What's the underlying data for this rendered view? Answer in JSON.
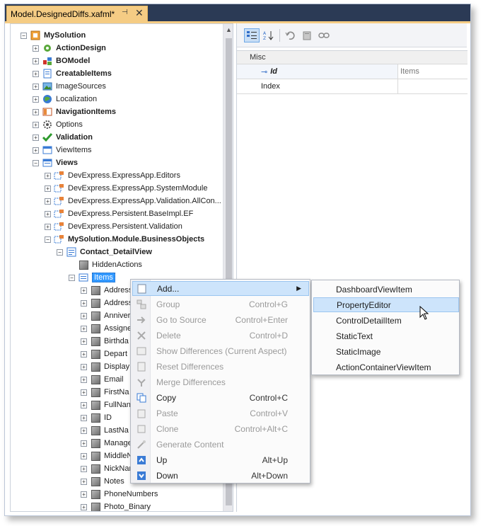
{
  "tab": {
    "title": "Model.DesignedDiffs.xafml*",
    "pin_glyph": "⊣",
    "close_glyph": "✕"
  },
  "tree": {
    "items": [
      {
        "label": "MySolution",
        "bold": true,
        "icon": "solution-icon"
      },
      {
        "label": "ActionDesign",
        "bold": true,
        "icon": "action-design-icon"
      },
      {
        "label": "BOModel",
        "bold": true,
        "icon": "bo-model-icon"
      },
      {
        "label": "CreatableItems",
        "bold": true,
        "icon": "creatable-items-icon"
      },
      {
        "label": "ImageSources",
        "bold": false,
        "icon": "image-sources-icon"
      },
      {
        "label": "Localization",
        "bold": false,
        "icon": "localization-icon"
      },
      {
        "label": "NavigationItems",
        "bold": true,
        "icon": "navigation-items-icon"
      },
      {
        "label": "Options",
        "bold": false,
        "icon": "options-icon"
      },
      {
        "label": "Validation",
        "bold": true,
        "icon": "validation-icon"
      },
      {
        "label": "ViewItems",
        "bold": false,
        "icon": "view-items-icon"
      },
      {
        "label": "Views",
        "bold": true,
        "icon": "views-icon"
      },
      {
        "label": "DevExpress.ExpressApp.Editors",
        "bold": false,
        "icon": "namespace-icon"
      },
      {
        "label": "DevExpress.ExpressApp.SystemModule",
        "bold": false,
        "icon": "namespace-icon"
      },
      {
        "label": "DevExpress.ExpressApp.Validation.AllCon...",
        "bold": false,
        "icon": "namespace-icon"
      },
      {
        "label": "DevExpress.Persistent.BaseImpl.EF",
        "bold": false,
        "icon": "namespace-icon"
      },
      {
        "label": "DevExpress.Persistent.Validation",
        "bold": false,
        "icon": "namespace-icon"
      },
      {
        "label": "MySolution.Module.BusinessObjects",
        "bold": true,
        "icon": "namespace-icon"
      },
      {
        "label": "Contact_DetailView",
        "bold": true,
        "icon": "detail-view-icon"
      },
      {
        "label": "HiddenActions",
        "bold": false,
        "icon": "cube-icon"
      },
      {
        "label": "Items",
        "bold": false,
        "icon": "items-icon"
      },
      {
        "label": "Address",
        "bold": false,
        "icon": "cube-icon"
      },
      {
        "label": "Address",
        "bold": false,
        "icon": "cube-icon"
      },
      {
        "label": "Anniver",
        "bold": false,
        "icon": "cube-icon"
      },
      {
        "label": "Assigne",
        "bold": false,
        "icon": "cube-icon"
      },
      {
        "label": "Birthda",
        "bold": false,
        "icon": "cube-icon"
      },
      {
        "label": "Depart",
        "bold": false,
        "icon": "cube-icon"
      },
      {
        "label": "Display",
        "bold": false,
        "icon": "cube-icon"
      },
      {
        "label": "Email",
        "bold": false,
        "icon": "cube-icon"
      },
      {
        "label": "FirstNa",
        "bold": false,
        "icon": "cube-icon"
      },
      {
        "label": "FullNan",
        "bold": false,
        "icon": "cube-icon"
      },
      {
        "label": "ID",
        "bold": false,
        "icon": "cube-icon"
      },
      {
        "label": "LastNa",
        "bold": false,
        "icon": "cube-icon"
      },
      {
        "label": "Manage",
        "bold": false,
        "icon": "cube-icon"
      },
      {
        "label": "MiddleN",
        "bold": false,
        "icon": "cube-icon"
      },
      {
        "label": "NickNan",
        "bold": false,
        "icon": "cube-icon"
      },
      {
        "label": "Notes",
        "bold": false,
        "icon": "cube-icon"
      },
      {
        "label": "PhoneNumbers",
        "bold": false,
        "icon": "cube-icon"
      },
      {
        "label": "Photo_Binary",
        "bold": false,
        "icon": "cube-icon"
      }
    ]
  },
  "property_grid": {
    "toolbar": {
      "categorized_icon": "categorized-icon",
      "alphabetical_icon": "alphabetical-icon",
      "undo_icon": "undo-icon",
      "delete_icon": "delete-icon",
      "link_icon": "link-icon"
    },
    "category": "Misc",
    "rows": [
      {
        "name": "Id",
        "value": "Items"
      },
      {
        "name": "Index",
        "value": ""
      }
    ]
  },
  "context_menu": {
    "items": [
      {
        "label": "Add...",
        "shortcut": "",
        "enabled": true,
        "icon": "add-icon",
        "submenu": true
      },
      {
        "label": "Group",
        "shortcut": "Control+G",
        "enabled": false,
        "icon": "group-icon"
      },
      {
        "label": "Go to Source",
        "shortcut": "Control+Enter",
        "enabled": false,
        "icon": "go-to-source-icon"
      },
      {
        "label": "Delete",
        "shortcut": "Control+D",
        "enabled": false,
        "icon": "delete-icon"
      },
      {
        "label": "Show Differences (Current Aspect)",
        "shortcut": "",
        "enabled": false,
        "icon": "show-differences-icon"
      },
      {
        "label": "Reset Differences",
        "shortcut": "",
        "enabled": false,
        "icon": "reset-differences-icon"
      },
      {
        "label": "Merge Differences",
        "shortcut": "",
        "enabled": false,
        "icon": "merge-differences-icon"
      },
      {
        "label": "Copy",
        "shortcut": "Control+C",
        "enabled": true,
        "icon": "copy-icon"
      },
      {
        "label": "Paste",
        "shortcut": "Control+V",
        "enabled": false,
        "icon": "paste-icon"
      },
      {
        "label": "Clone",
        "shortcut": "Control+Alt+C",
        "enabled": false,
        "icon": "clone-icon"
      },
      {
        "label": "Generate Content",
        "shortcut": "",
        "enabled": false,
        "icon": "generate-content-icon"
      },
      {
        "label": "Up",
        "shortcut": "Alt+Up",
        "enabled": true,
        "icon": "up-icon"
      },
      {
        "label": "Down",
        "shortcut": "Alt+Down",
        "enabled": true,
        "icon": "down-icon"
      }
    ],
    "submenu_arrow": "▶"
  },
  "submenu": {
    "items": [
      {
        "label": "DashboardViewItem"
      },
      {
        "label": "PropertyEditor"
      },
      {
        "label": "ControlDetailItem"
      },
      {
        "label": "StaticText"
      },
      {
        "label": "StaticImage"
      },
      {
        "label": "ActionContainerViewItem"
      }
    ]
  }
}
